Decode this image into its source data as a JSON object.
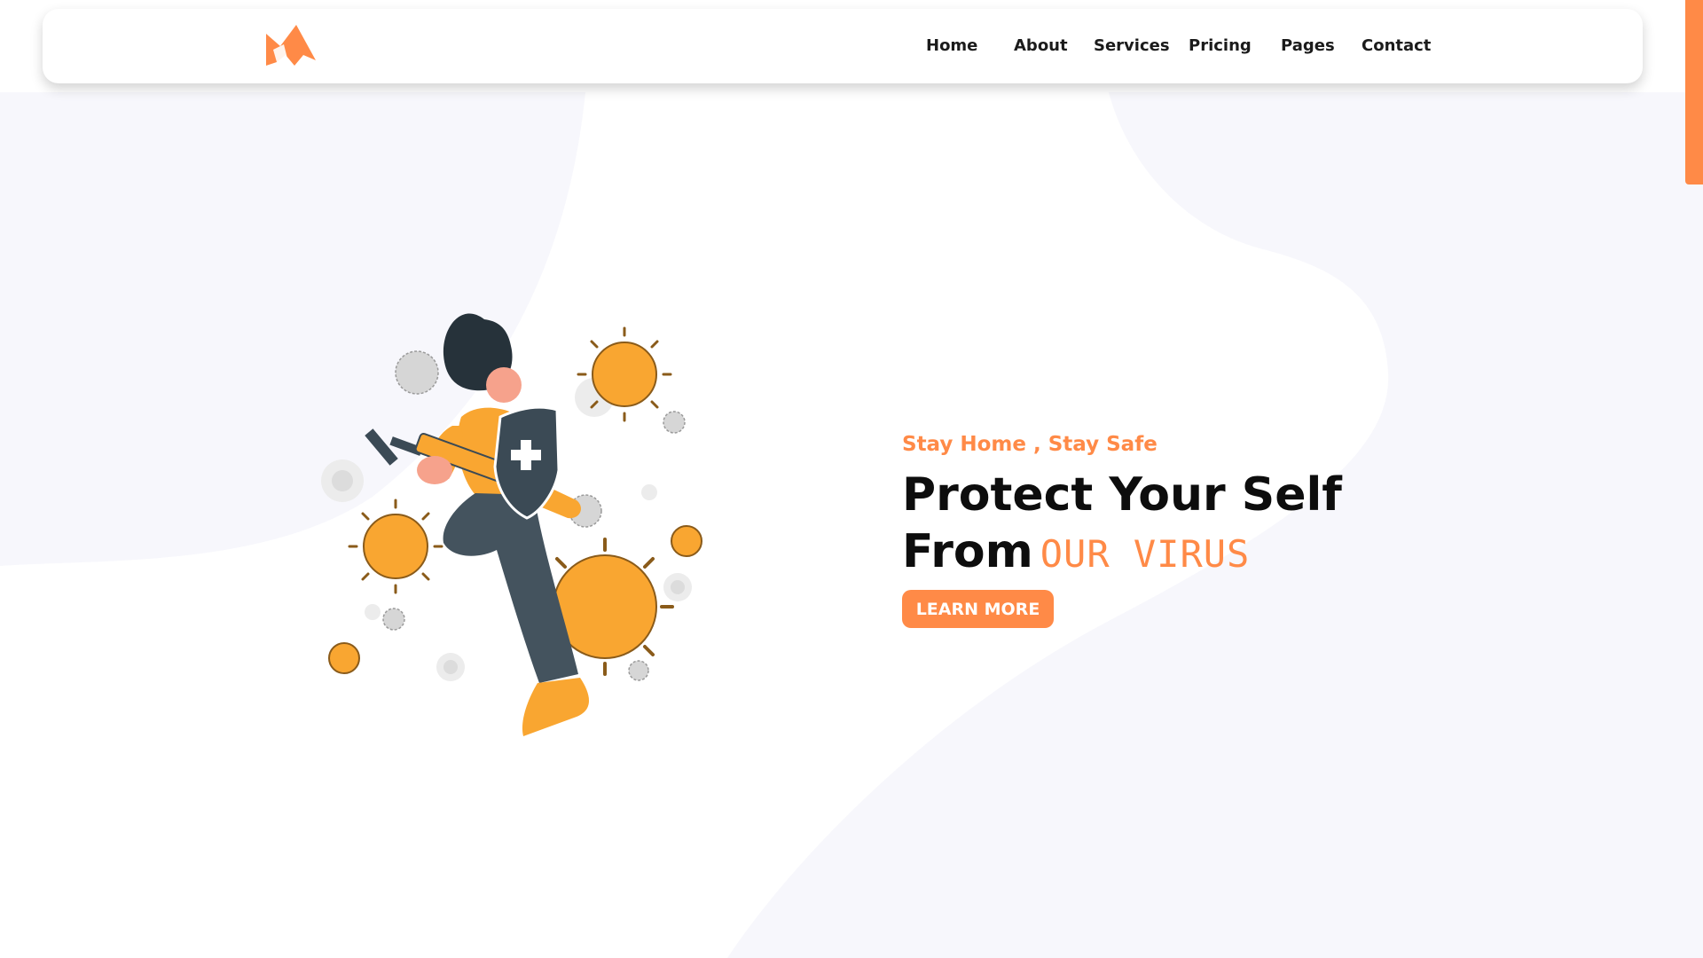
{
  "nav": {
    "items": [
      {
        "label": "Home"
      },
      {
        "label": "About"
      },
      {
        "label": "Services"
      },
      {
        "label": "Pricing"
      },
      {
        "label": "Pages"
      },
      {
        "label": "Contact"
      }
    ]
  },
  "logo": {
    "icon": "brand-logo-icon"
  },
  "hero": {
    "tagline": "Stay Home , Stay Safe",
    "headline_line1": "Protect Your Self",
    "headline_line2": "From",
    "headline_accent": "OUR VIRUS",
    "cta_label": "LEARN MORE"
  },
  "illustration": {
    "icon": "woman-with-shield-and-syringe-fighting-virus-illustration"
  },
  "colors": {
    "accent": "#ff8a47",
    "text": "#0d0d0d",
    "background_tint": "#f7f7fc",
    "virus": "#f9a631",
    "virus_grey": "#d6d6d6",
    "shield": "#3b4a55"
  }
}
